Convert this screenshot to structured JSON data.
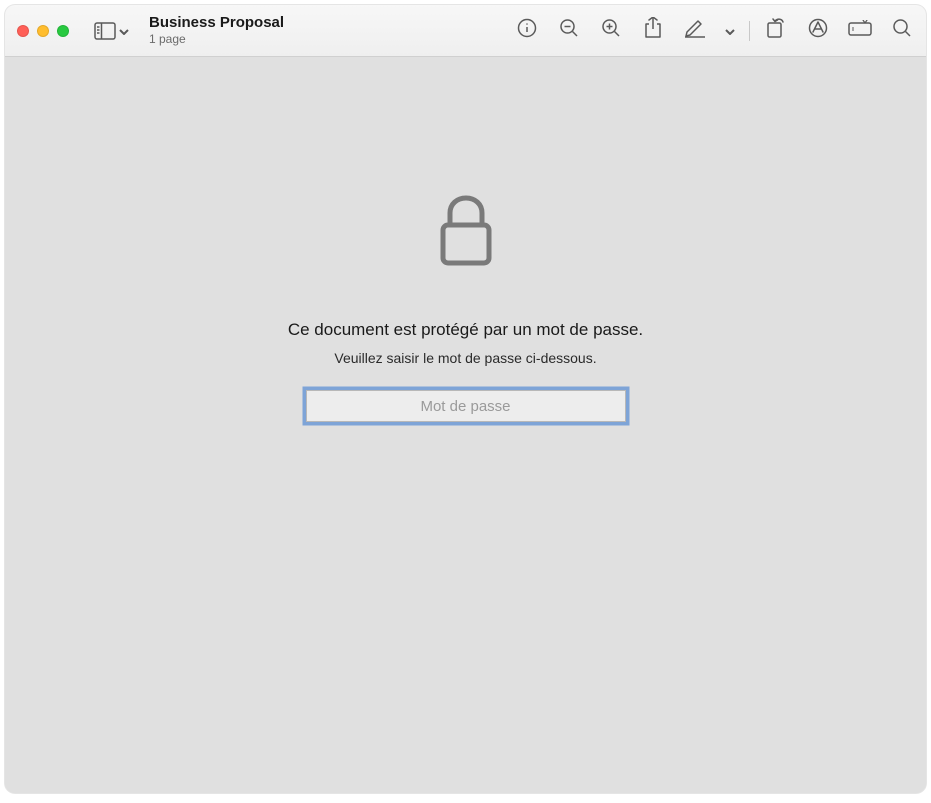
{
  "window": {
    "title": "Business Proposal",
    "subtitle": "1 page"
  },
  "toolbar": {
    "icons": {
      "sidebar": "sidebar-icon",
      "inspector": "info-icon",
      "zoom_out": "zoom-out-icon",
      "zoom_in": "zoom-in-icon",
      "share": "share-icon",
      "highlight": "highlight-icon",
      "rotate": "rotate-icon",
      "markup": "markup-icon",
      "crop": "crop-icon",
      "search": "search-icon"
    }
  },
  "lock_screen": {
    "heading": "Ce document est protégé par un mot de passe.",
    "subtext": "Veuillez saisir le mot de passe ci-dessous.",
    "placeholder": "Mot de passe",
    "value": ""
  }
}
